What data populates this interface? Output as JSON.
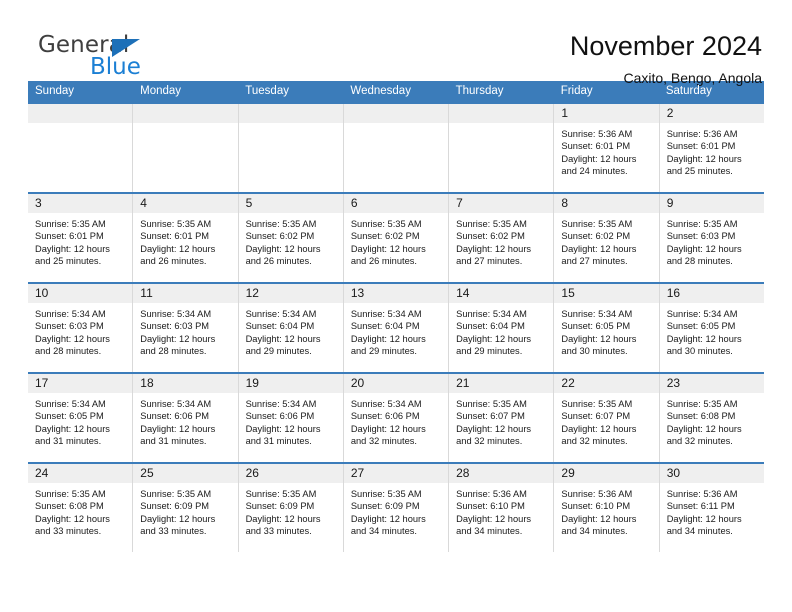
{
  "brand": {
    "name_part1": "General",
    "name_part2": "Blue",
    "triangle_icon": "triangle-icon",
    "accent_color": "#1b7fd4"
  },
  "header": {
    "title": "November 2024",
    "subtitle": "Caxito, Bengo, Angola"
  },
  "calendar": {
    "header_color": "#3b7cba",
    "weekdays": [
      "Sunday",
      "Monday",
      "Tuesday",
      "Wednesday",
      "Thursday",
      "Friday",
      "Saturday"
    ],
    "weeks": [
      [
        {
          "day": "",
          "sunrise": "",
          "sunset": "",
          "daylight": ""
        },
        {
          "day": "",
          "sunrise": "",
          "sunset": "",
          "daylight": ""
        },
        {
          "day": "",
          "sunrise": "",
          "sunset": "",
          "daylight": ""
        },
        {
          "day": "",
          "sunrise": "",
          "sunset": "",
          "daylight": ""
        },
        {
          "day": "",
          "sunrise": "",
          "sunset": "",
          "daylight": ""
        },
        {
          "day": "1",
          "sunrise": "Sunrise: 5:36 AM",
          "sunset": "Sunset: 6:01 PM",
          "daylight": "Daylight: 12 hours and 24 minutes."
        },
        {
          "day": "2",
          "sunrise": "Sunrise: 5:36 AM",
          "sunset": "Sunset: 6:01 PM",
          "daylight": "Daylight: 12 hours and 25 minutes."
        }
      ],
      [
        {
          "day": "3",
          "sunrise": "Sunrise: 5:35 AM",
          "sunset": "Sunset: 6:01 PM",
          "daylight": "Daylight: 12 hours and 25 minutes."
        },
        {
          "day": "4",
          "sunrise": "Sunrise: 5:35 AM",
          "sunset": "Sunset: 6:01 PM",
          "daylight": "Daylight: 12 hours and 26 minutes."
        },
        {
          "day": "5",
          "sunrise": "Sunrise: 5:35 AM",
          "sunset": "Sunset: 6:02 PM",
          "daylight": "Daylight: 12 hours and 26 minutes."
        },
        {
          "day": "6",
          "sunrise": "Sunrise: 5:35 AM",
          "sunset": "Sunset: 6:02 PM",
          "daylight": "Daylight: 12 hours and 26 minutes."
        },
        {
          "day": "7",
          "sunrise": "Sunrise: 5:35 AM",
          "sunset": "Sunset: 6:02 PM",
          "daylight": "Daylight: 12 hours and 27 minutes."
        },
        {
          "day": "8",
          "sunrise": "Sunrise: 5:35 AM",
          "sunset": "Sunset: 6:02 PM",
          "daylight": "Daylight: 12 hours and 27 minutes."
        },
        {
          "day": "9",
          "sunrise": "Sunrise: 5:35 AM",
          "sunset": "Sunset: 6:03 PM",
          "daylight": "Daylight: 12 hours and 28 minutes."
        }
      ],
      [
        {
          "day": "10",
          "sunrise": "Sunrise: 5:34 AM",
          "sunset": "Sunset: 6:03 PM",
          "daylight": "Daylight: 12 hours and 28 minutes."
        },
        {
          "day": "11",
          "sunrise": "Sunrise: 5:34 AM",
          "sunset": "Sunset: 6:03 PM",
          "daylight": "Daylight: 12 hours and 28 minutes."
        },
        {
          "day": "12",
          "sunrise": "Sunrise: 5:34 AM",
          "sunset": "Sunset: 6:04 PM",
          "daylight": "Daylight: 12 hours and 29 minutes."
        },
        {
          "day": "13",
          "sunrise": "Sunrise: 5:34 AM",
          "sunset": "Sunset: 6:04 PM",
          "daylight": "Daylight: 12 hours and 29 minutes."
        },
        {
          "day": "14",
          "sunrise": "Sunrise: 5:34 AM",
          "sunset": "Sunset: 6:04 PM",
          "daylight": "Daylight: 12 hours and 29 minutes."
        },
        {
          "day": "15",
          "sunrise": "Sunrise: 5:34 AM",
          "sunset": "Sunset: 6:05 PM",
          "daylight": "Daylight: 12 hours and 30 minutes."
        },
        {
          "day": "16",
          "sunrise": "Sunrise: 5:34 AM",
          "sunset": "Sunset: 6:05 PM",
          "daylight": "Daylight: 12 hours and 30 minutes."
        }
      ],
      [
        {
          "day": "17",
          "sunrise": "Sunrise: 5:34 AM",
          "sunset": "Sunset: 6:05 PM",
          "daylight": "Daylight: 12 hours and 31 minutes."
        },
        {
          "day": "18",
          "sunrise": "Sunrise: 5:34 AM",
          "sunset": "Sunset: 6:06 PM",
          "daylight": "Daylight: 12 hours and 31 minutes."
        },
        {
          "day": "19",
          "sunrise": "Sunrise: 5:34 AM",
          "sunset": "Sunset: 6:06 PM",
          "daylight": "Daylight: 12 hours and 31 minutes."
        },
        {
          "day": "20",
          "sunrise": "Sunrise: 5:34 AM",
          "sunset": "Sunset: 6:06 PM",
          "daylight": "Daylight: 12 hours and 32 minutes."
        },
        {
          "day": "21",
          "sunrise": "Sunrise: 5:35 AM",
          "sunset": "Sunset: 6:07 PM",
          "daylight": "Daylight: 12 hours and 32 minutes."
        },
        {
          "day": "22",
          "sunrise": "Sunrise: 5:35 AM",
          "sunset": "Sunset: 6:07 PM",
          "daylight": "Daylight: 12 hours and 32 minutes."
        },
        {
          "day": "23",
          "sunrise": "Sunrise: 5:35 AM",
          "sunset": "Sunset: 6:08 PM",
          "daylight": "Daylight: 12 hours and 32 minutes."
        }
      ],
      [
        {
          "day": "24",
          "sunrise": "Sunrise: 5:35 AM",
          "sunset": "Sunset: 6:08 PM",
          "daylight": "Daylight: 12 hours and 33 minutes."
        },
        {
          "day": "25",
          "sunrise": "Sunrise: 5:35 AM",
          "sunset": "Sunset: 6:09 PM",
          "daylight": "Daylight: 12 hours and 33 minutes."
        },
        {
          "day": "26",
          "sunrise": "Sunrise: 5:35 AM",
          "sunset": "Sunset: 6:09 PM",
          "daylight": "Daylight: 12 hours and 33 minutes."
        },
        {
          "day": "27",
          "sunrise": "Sunrise: 5:35 AM",
          "sunset": "Sunset: 6:09 PM",
          "daylight": "Daylight: 12 hours and 34 minutes."
        },
        {
          "day": "28",
          "sunrise": "Sunrise: 5:36 AM",
          "sunset": "Sunset: 6:10 PM",
          "daylight": "Daylight: 12 hours and 34 minutes."
        },
        {
          "day": "29",
          "sunrise": "Sunrise: 5:36 AM",
          "sunset": "Sunset: 6:10 PM",
          "daylight": "Daylight: 12 hours and 34 minutes."
        },
        {
          "day": "30",
          "sunrise": "Sunrise: 5:36 AM",
          "sunset": "Sunset: 6:11 PM",
          "daylight": "Daylight: 12 hours and 34 minutes."
        }
      ]
    ]
  }
}
